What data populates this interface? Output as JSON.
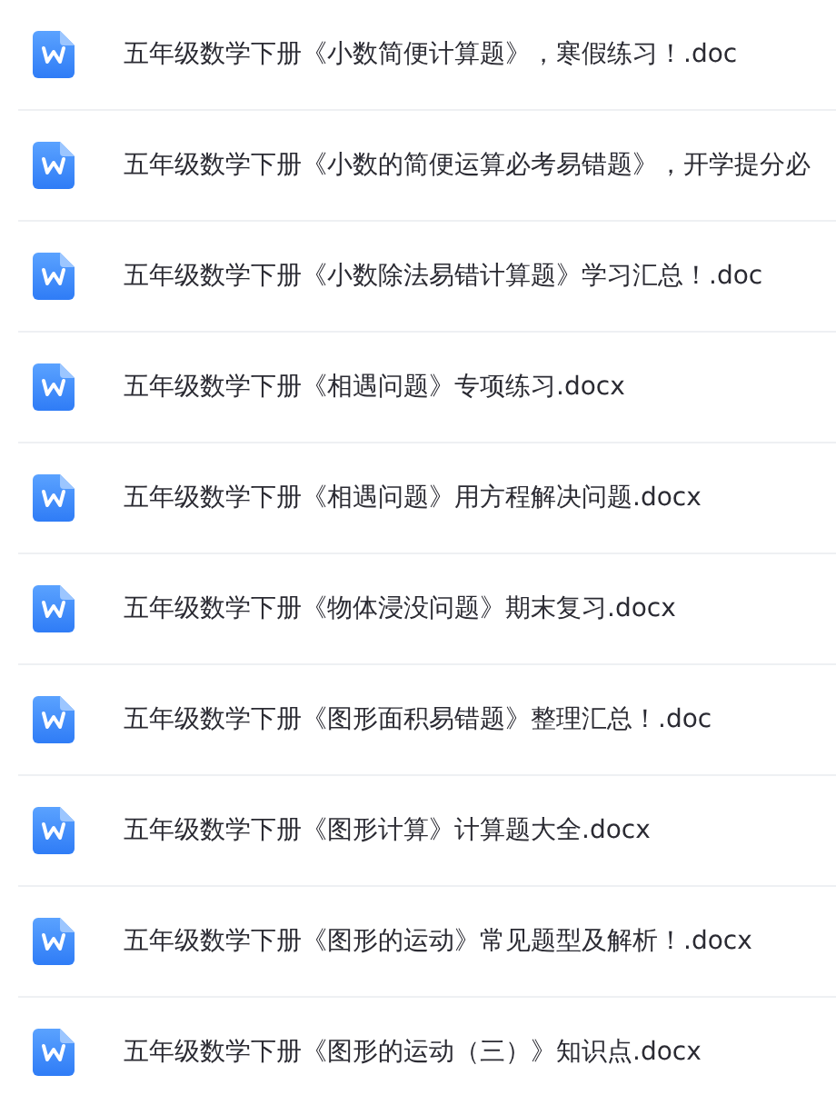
{
  "files": [
    {
      "name": "五年级数学下册《小数简便计算题》，寒假练习！.doc"
    },
    {
      "name": "五年级数学下册《小数的简便运算必考易错题》，开学提分必"
    },
    {
      "name": "五年级数学下册《小数除法易错计算题》学习汇总！.doc"
    },
    {
      "name": "五年级数学下册《相遇问题》专项练习.docx"
    },
    {
      "name": "五年级数学下册《相遇问题》用方程解决问题.docx"
    },
    {
      "name": "五年级数学下册《物体浸没问题》期末复习.docx"
    },
    {
      "name": "五年级数学下册《图形面积易错题》整理汇总！.doc"
    },
    {
      "name": "五年级数学下册《图形计算》计算题大全.docx"
    },
    {
      "name": "五年级数学下册《图形的运动》常见题型及解析！.docx"
    },
    {
      "name": "五年级数学下册《图形的运动（三）》知识点.docx"
    }
  ]
}
